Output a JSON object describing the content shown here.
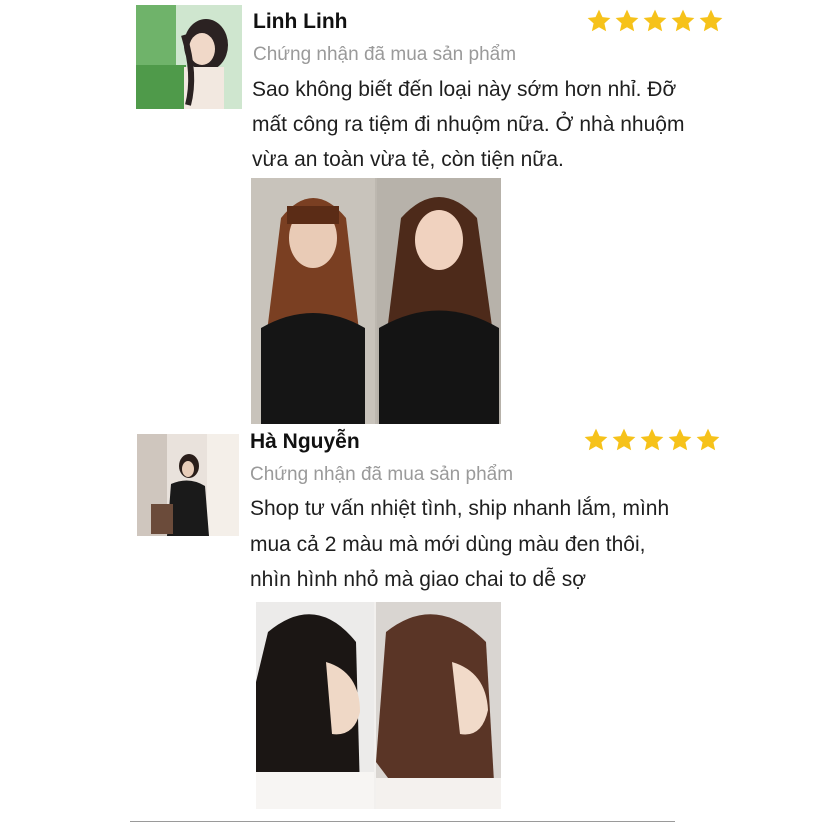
{
  "colors": {
    "star": "#F6C21A",
    "verified_text": "#9a9a9a",
    "divider": "#9a9a9a"
  },
  "reviews": [
    {
      "name": "Linh Linh",
      "verified": "Chứng nhận đã mua sản phẩm",
      "rating": 5,
      "lines": [
        "Sao không biết đến loại này sớm hơn nhỉ. Đỡ",
        "mất công ra tiệm đi nhuộm nữa. Ở nhà nhuộm",
        "vừa an toàn vừa tẻ, còn tiện nữa."
      ]
    },
    {
      "name": "Hà Nguyễn",
      "verified": "Chứng nhận đã mua sản phẩm",
      "rating": 5,
      "lines": [
        "Shop tư vấn nhiệt tình, ship nhanh lắm, mình",
        "mua cả 2 màu mà mới dùng màu đen thôi,",
        "nhìn hình nhỏ mà giao chai to dễ sợ"
      ]
    }
  ]
}
